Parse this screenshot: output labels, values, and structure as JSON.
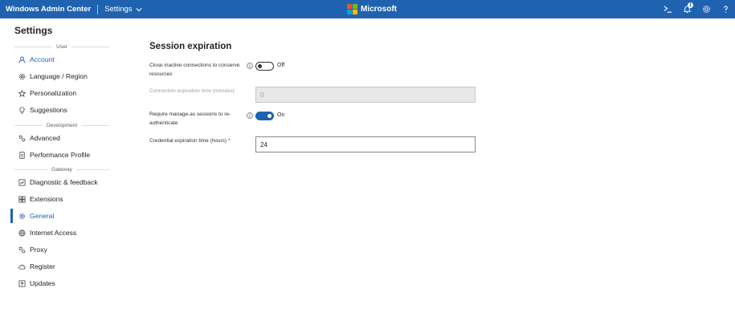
{
  "topbar": {
    "app_title": "Windows Admin Center",
    "section_label": "Settings",
    "brand": "Microsoft",
    "notification_count": "1",
    "colors": {
      "bar": "#1f63b0",
      "ms_red": "#f25022",
      "ms_green": "#7fba00",
      "ms_blue": "#00a4ef",
      "ms_yellow": "#ffb900"
    },
    "icons": [
      "powershell-icon",
      "notifications-icon",
      "settings-gear-icon",
      "help-icon"
    ]
  },
  "sidebar": {
    "title": "Settings",
    "groups": {
      "user": "User",
      "development": "Development",
      "gateway": "Gateway"
    },
    "items": {
      "account": "Account",
      "language": "Language / Region",
      "personalization": "Personalization",
      "suggestions": "Suggestions",
      "advanced": "Advanced",
      "performance": "Performance Profile",
      "diagnostic": "Diagnostic & feedback",
      "extensions": "Extensions",
      "general": "General",
      "internet": "Internet Access",
      "proxy": "Proxy",
      "register": "Register",
      "updates": "Updates"
    },
    "selected": "General"
  },
  "main": {
    "title": "Session expiration",
    "close_inactive": {
      "label": "Close inactive connections to conserve resources",
      "state": "Off"
    },
    "connection_expiration": {
      "label": "Connection expiration time (minutes)",
      "value": "0"
    },
    "require_manage_as": {
      "label": "Require manage-as sessions to re-authenticate",
      "state": "On"
    },
    "credential_expiration": {
      "label": "Credential expiration time (hours)",
      "required_marker": "*",
      "value": "24"
    }
  }
}
